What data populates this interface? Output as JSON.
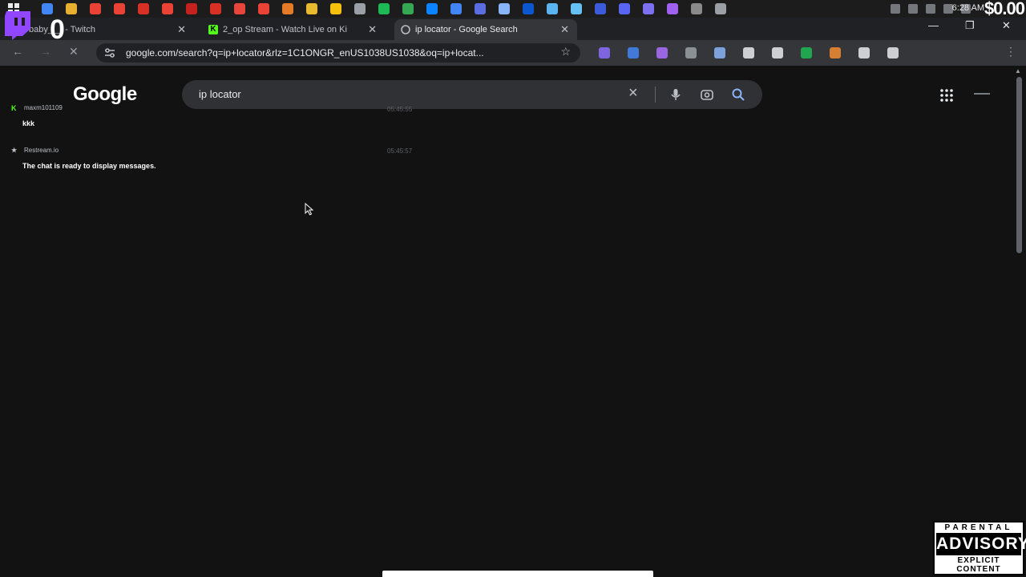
{
  "taskbar": {
    "time": "6:28 AM",
    "icon_colors": [
      "#4285f4",
      "#e8b030",
      "#ea4335",
      "#ea4335",
      "#d93025",
      "#ea4335",
      "#c5221f",
      "#d93025",
      "#e8453c",
      "#ea4335",
      "#e57b26",
      "#e8ba30",
      "#f4c20d",
      "#9aa0a6",
      "#1db954",
      "#34a853",
      "#0a84ff",
      "#4285f4",
      "#5b6ee1",
      "#8ab4f8",
      "#0b57d0",
      "#5bb4f0",
      "#66c0f4",
      "#3b5bdb",
      "#5865f2",
      "#7c6ff0",
      "#a060f0",
      "#8a8a8a",
      "#9aa0a6"
    ]
  },
  "overlay": {
    "donation": "$0.00",
    "viewer_count": "0"
  },
  "browser": {
    "tabs": [
      {
        "title": "baby___ - Twitch",
        "icon": "twitch-icon",
        "color": "#9146ff"
      },
      {
        "title": "2_op Stream - Watch Live on Ki",
        "icon": "kick-icon",
        "color": "#53fc18"
      },
      {
        "title": "ip locator - Google Search",
        "icon": "google-icon",
        "color": "#bdc1c6"
      }
    ],
    "url": "google.com/search?q=ip+locator&rlz=1C1ONGR_enUS1038US1038&oq=ip+locat...",
    "extension_colors": [
      "#8b6cff",
      "#4285f4",
      "#a970ff",
      "#9aa0a6",
      "#8ab4f8",
      "#e8eaed",
      "#e8eaed",
      "#1db954",
      "#f28b30",
      "#e8eaed",
      "#e8eaed"
    ]
  },
  "google": {
    "logo": "Google",
    "query": "ip locator"
  },
  "chat": {
    "messages": [
      {
        "user": "maxm101109",
        "text": "kkk",
        "time": "05:45:55",
        "icon": "K",
        "icon_color": "#53fc18"
      },
      {
        "user": "Restream.io",
        "text": "The chat is ready to display messages.",
        "time": "05:45:57",
        "icon": "★",
        "icon_color": "#bdc1c6"
      }
    ]
  },
  "advisory": {
    "top": "PARENTAL",
    "middle": "ADVISORY",
    "bottom": "EXPLICIT CONTENT"
  }
}
